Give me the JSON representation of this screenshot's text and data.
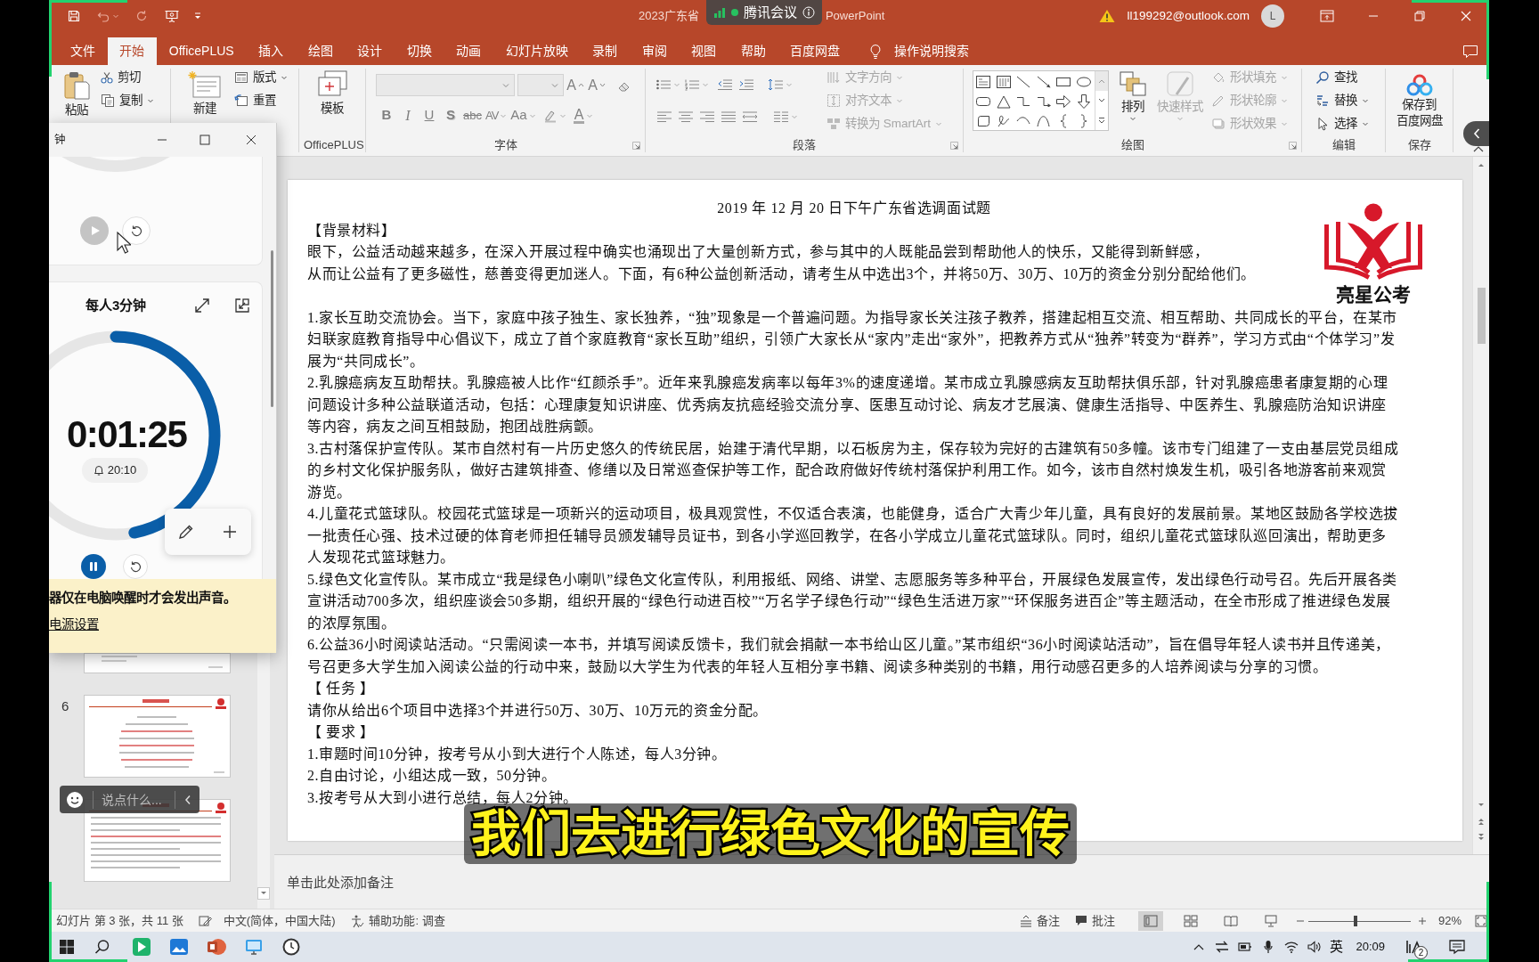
{
  "title_bar": {
    "title": "2023广东省",
    "meeting": "腾讯会议",
    "app_name": "PowerPoint",
    "account": "ll199292@outlook.com",
    "avatar": "L"
  },
  "tabs": [
    {
      "label": "文件",
      "selected": false
    },
    {
      "label": "开始",
      "selected": true
    },
    {
      "label": "OfficePLUS",
      "selected": false
    },
    {
      "label": "插入",
      "selected": false
    },
    {
      "label": "绘图",
      "selected": false
    },
    {
      "label": "设计",
      "selected": false
    },
    {
      "label": "切换",
      "selected": false
    },
    {
      "label": "动画",
      "selected": false
    },
    {
      "label": "幻灯片放映",
      "selected": false
    },
    {
      "label": "录制",
      "selected": false
    },
    {
      "label": "审阅",
      "selected": false
    },
    {
      "label": "视图",
      "selected": false
    },
    {
      "label": "帮助",
      "selected": false
    },
    {
      "label": "百度网盘",
      "selected": false
    }
  ],
  "tell_me": "操作说明搜索",
  "ribbon": {
    "clipboard": {
      "paste": "粘贴",
      "cut": "剪切",
      "copy": "复制"
    },
    "slides": {
      "new_slide": "新建",
      "layout": "版式",
      "reset": "重置"
    },
    "officeplus": {
      "template": "模板",
      "group_label": "OfficePLUS"
    },
    "font": {
      "group_label": "字体",
      "grow": "A",
      "shrink": "A",
      "styles": [
        "B",
        "I",
        "U",
        "S",
        "abc",
        "AV",
        "Aa"
      ],
      "foreground": "A"
    },
    "paragraph": {
      "group_label": "段落",
      "commands": [
        {
          "label": "文字方向",
          "disabled": true
        },
        {
          "label": "对齐文本",
          "disabled": true
        },
        {
          "label": "转换为 SmartArt",
          "disabled": true
        }
      ]
    },
    "drawing": {
      "group_label": "绘图",
      "arrange": "排列",
      "quick_styles": {
        "label": "快速样式",
        "disabled": true
      },
      "commands": [
        {
          "label": "形状填充",
          "disabled": true
        },
        {
          "label": "形状轮廓",
          "disabled": true
        },
        {
          "label": "形状效果",
          "disabled": true
        }
      ]
    },
    "editing": {
      "group_label": "编辑",
      "commands": [
        {
          "label": "查找",
          "dropdown": false
        },
        {
          "label": "替换",
          "dropdown": true
        },
        {
          "label": "选择",
          "dropdown": true
        }
      ]
    },
    "save": {
      "group_label": "保存",
      "button": [
        "保存到",
        "百度网盘"
      ]
    }
  },
  "clock_window": {
    "title": "钟",
    "timers": [
      {
        "running": false
      },
      {
        "name": "每人3分钟",
        "time": "0:01:25",
        "alarm": "20:10",
        "level": 0.47,
        "running": true
      }
    ],
    "notice": {
      "text": "器仅在电脑唤醒时才会发出声音。",
      "link": "电源设置"
    }
  },
  "thumbnails": [
    {
      "selected": false
    },
    {
      "number": "6",
      "selected": false
    },
    {
      "selected": false
    }
  ],
  "chat": {
    "placeholder": "说点什么..."
  },
  "slide": {
    "title": "2019 年 12 月 20 日下午广东省选调面试题",
    "logo_text": "亮星公考",
    "blocks": [
      {
        "kind": "heading",
        "text": "【背景材料】"
      },
      {
        "kind": "text",
        "text": "眼下，公益活动越来越多，在深入开展过程中确实也涌现出了大量创新方式，参与其中的人既能品尝到帮助他人的快乐，又能得到新鲜感，"
      },
      {
        "kind": "text",
        "text": "从而让公益有了更多磁性，慈善变得更加迷人。下面，有6种公益创新活动，请考生从中选出3个，并将50万、30万、10万的资金分别分配给他们。"
      },
      {
        "kind": "item",
        "text": "1.家长互助交流协会。当下，家庭中孩子独生、家长独养，“独”现象是一个普遍问题。为指导家长关注孩子教养，搭建起相互交流、相互帮助、共同成长的平台，在某市妇联家庭教育指导中心倡议下，成立了首个家庭教育“家长互助”组织，引领广大家长从“家内”走出“家外”，把教养方式从“独养”转变为“群养”，学习方式由“个体学习”发展为“共同成长”。"
      },
      {
        "kind": "item",
        "text": "2.乳腺癌病友互助帮扶。乳腺癌被人比作“红颜杀手”。近年来乳腺癌发病率以每年3%的速度递增。某市成立乳腺感病友互助帮扶俱乐部，针对乳腺癌患者康复期的心理问题设计多种公益联道活动，包括：心理康复知识讲座、优秀病友抗癌经验交流分享、医患互动讨论、病友才艺展演、健康生活指导、中医养生、乳腺癌防治知识讲座等内容，病友之间互相鼓励，抱团战胜病颤。"
      },
      {
        "kind": "item",
        "text": "3.古村落保护宣传队。某市自然村有一片历史悠久的传统民居，始建于清代早期，以石板房为主，保存较为完好的古建筑有50多幢。该市专门组建了一支由基层党员组成的乡村文化保护服务队，做好古建筑排查、修缮以及日常巡查保护等工作，配合政府做好传统村落保护利用工作。如今，该市自然村焕发生机，吸引各地游客前来观赏游览。"
      },
      {
        "kind": "item",
        "text": "4.儿童花式篮球队。校园花式篮球是一项新兴的运动项目，极具观赏性，不仅适合表演，也能健身，适合广大青少年儿童，具有良好的发展前景。某地区鼓励各学校选拔一批责任心强、技术过硬的体育老师担任辅导员颁发辅导员证书，到各小学巡回教学，在各小学成立儿童花式篮球队。同时，组织儿童花式篮球队巡回演出，帮助更多人发现花式篮球魅力。"
      },
      {
        "kind": "item",
        "text": "5.绿色文化宣传队。某市成立“我是绿色小喇叭”绿色文化宣传队，利用报纸、网络、讲堂、志愿服务等多种平台，开展绿色发展宣传，发出绿色行动号召。先后开展各类宣讲活动700多次，组织座谈会50多期，组织开展的“绿色行动进百校”“万名学子绿色行动”“绿色生活进万家”“环保服务进百企”等主题活动，在全市形成了推进绿色发展的浓厚氛围。"
      },
      {
        "kind": "item",
        "text": "6.公益36小时阅读站活动。“只需阅读一本书，并填写阅读反馈卡，我们就会捐献一本书给山区儿童。”某市组织“36小时阅读站活动”，旨在倡导年轻人读书并且传递美，号召更多大学生加入阅读公益的行动中来，鼓励以大学生为代表的年轻人互相分享书籍、阅读多种类别的书籍，用行动感召更多的人培养阅读与分享的习惯。"
      },
      {
        "kind": "heading",
        "text": "【 任务 】"
      },
      {
        "kind": "text",
        "text": "请你从给出6个项目中选择3个并进行50万、30万、10万元的资金分配。"
      },
      {
        "kind": "heading",
        "text": "【 要求 】"
      },
      {
        "kind": "item",
        "text": "1.审题时间10分钟，按考号从小到大进行个人陈述，每人3分钟。"
      },
      {
        "kind": "item",
        "text": "2.自由讨论，小组达成一致，50分钟。"
      },
      {
        "kind": "item",
        "text": "3.按考号从大到小进行总结，每人2分钟。"
      }
    ]
  },
  "notes": {
    "placeholder": "单击此处添加备注"
  },
  "subtitle": "我们去进行绿色文化的宣传",
  "status_bar": {
    "slide_info": "幻灯片 第 3 张，共 11 张",
    "language": "中文(简体，中国大陆)",
    "accessibility": "辅助功能: 调查",
    "notes": "备注",
    "comments": "批注",
    "views": [
      {
        "selected": true
      },
      {
        "selected": false
      },
      {
        "selected": false
      },
      {
        "selected": false
      }
    ],
    "zoom": {
      "level": 0.46,
      "reading": "92%"
    }
  },
  "taskbar": {
    "ime": "英",
    "time": "20:09",
    "badge": "2"
  }
}
